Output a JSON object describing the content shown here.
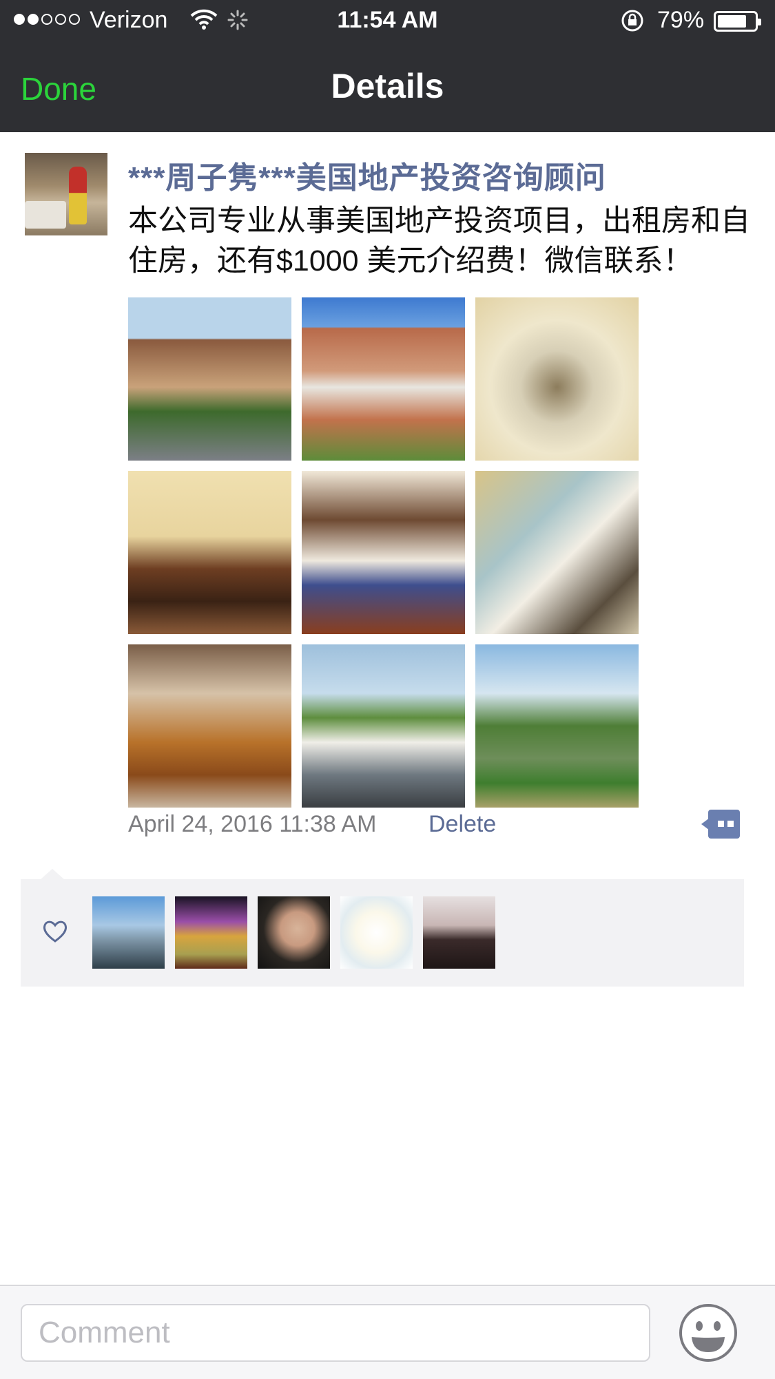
{
  "status_bar": {
    "carrier": "Verizon",
    "time": "11:54 AM",
    "battery": "79%",
    "battery_level": 0.79,
    "signal_bars_filled": 2,
    "signal_bars_total": 5
  },
  "nav": {
    "title": "Details",
    "done_label": "Done",
    "done_color": "#2bd43b"
  },
  "post": {
    "author": "***周子隽***美国地产投资咨询顾问",
    "text": "本公司专业从事美国地产投资项目，出租房和自住房，还有$1000 美元介绍费！微信联系！",
    "photo_count": 9,
    "timestamp": "April 24, 2016 11:38 AM",
    "delete_label": "Delete",
    "link_color": "#5b6b95"
  },
  "likes": {
    "liker_avatar_count": 5
  },
  "comment_bar": {
    "placeholder": "Comment"
  }
}
